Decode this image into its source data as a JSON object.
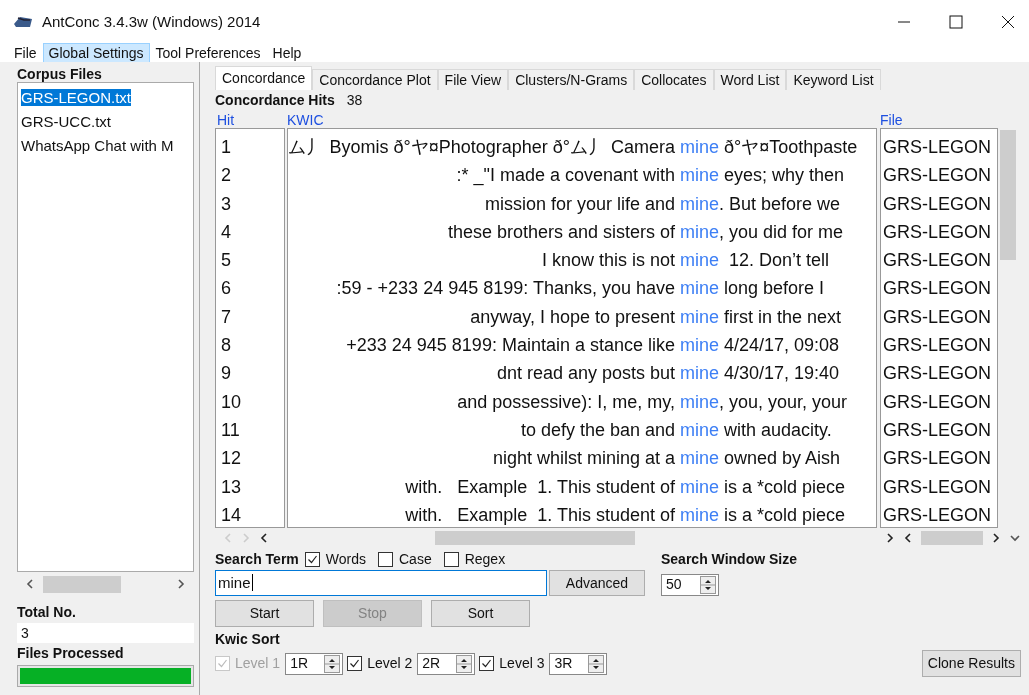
{
  "window": {
    "title": "AntConc 3.4.3w (Windows) 2014"
  },
  "menu": [
    {
      "label": "File",
      "selected": false
    },
    {
      "label": "Global Settings",
      "selected": true
    },
    {
      "label": "Tool Preferences",
      "selected": false
    },
    {
      "label": "Help",
      "selected": false
    }
  ],
  "corpus": {
    "heading": "Corpus Files",
    "files": [
      {
        "name": "GRS-LEGON.txt",
        "selected": true
      },
      {
        "name": "GRS-UCC.txt",
        "selected": false
      },
      {
        "name": "WhatsApp Chat with M",
        "selected": false
      }
    ],
    "total_label": "Total No.",
    "total": "3",
    "processed_label": "Files Processed",
    "progress": {
      "level": 1
    }
  },
  "tabs": [
    {
      "label": "Concordance",
      "selected": true
    },
    {
      "label": "Concordance Plot",
      "selected": false
    },
    {
      "label": "File View",
      "selected": false
    },
    {
      "label": "Clusters/N-Grams",
      "selected": false
    },
    {
      "label": "Collocates",
      "selected": false
    },
    {
      "label": "Word List",
      "selected": false
    },
    {
      "label": "Keyword List",
      "selected": false
    }
  ],
  "hits_label": "Concordance Hits",
  "hits": "38",
  "table": {
    "columns": [
      "Hit",
      "KWIC",
      "File"
    ],
    "rows": [
      {
        "hit": "1",
        "left": "ム丿 Byomis ð°ヤ¤Photographer ð°ム丿 Camera",
        "key": "mine",
        "right": " ð°ヤ¤Toothpaste",
        "file": "GRS-LEGON"
      },
      {
        "hit": "2",
        "left": ":* _\"I made a covenant with",
        "key": "mine",
        "right": " eyes; why then",
        "file": "GRS-LEGON"
      },
      {
        "hit": "3",
        "left": "mission for your life and",
        "key": "mine",
        "right": ". But before we",
        "file": "GRS-LEGON"
      },
      {
        "hit": "4",
        "left": "these brothers and sisters of",
        "key": "mine",
        "right": ", you did for me",
        "file": "GRS-LEGON"
      },
      {
        "hit": "5",
        "left": "I know this is not",
        "key": "mine",
        "right": "  12. Don’t tell",
        "file": "GRS-LEGON"
      },
      {
        "hit": "6",
        "left": ":59 - +233 24 945 8199: Thanks, you have",
        "key": "mine",
        "right": " long before I",
        "file": "GRS-LEGON"
      },
      {
        "hit": "7",
        "left": "anyway, I hope to present",
        "key": "mine",
        "right": " first in the next",
        "file": "GRS-LEGON"
      },
      {
        "hit": "8",
        "left": "+233 24 945 8199: Maintain a stance like",
        "key": "mine",
        "right": " 4/24/17, 09:08",
        "file": "GRS-LEGON"
      },
      {
        "hit": "9",
        "left": "dnt read any posts but",
        "key": "mine",
        "right": " 4/30/17, 19:40",
        "file": "GRS-LEGON"
      },
      {
        "hit": "10",
        "left": "and possessive): I, me, my,",
        "key": "mine",
        "right": ", you, your, your",
        "file": "GRS-LEGON"
      },
      {
        "hit": "11",
        "left": "to defy the ban and",
        "key": "mine",
        "right": " with audacity.",
        "file": "GRS-LEGON"
      },
      {
        "hit": "12",
        "left": "night whilst mining at a",
        "key": "mine",
        "right": " owned by Aish",
        "file": "GRS-LEGON"
      },
      {
        "hit": "13",
        "left": "with.   Example  1. This student of",
        "key": "mine",
        "right": " is a *cold piece",
        "file": "GRS-LEGON"
      },
      {
        "hit": "14",
        "left": "with.   Example  1. This student of",
        "key": "mine",
        "right": " is a *cold piece",
        "file": "GRS-LEGON"
      }
    ]
  },
  "search": {
    "label": "Search Term",
    "options": [
      {
        "label": "Words",
        "checked": true
      },
      {
        "label": "Case",
        "checked": false
      },
      {
        "label": "Regex",
        "checked": false
      }
    ],
    "value": "mine",
    "advanced": "Advanced",
    "window_label": "Search Window Size",
    "window_size": "50"
  },
  "actions": [
    {
      "label": "Start",
      "disabled": false
    },
    {
      "label": "Stop",
      "disabled": true
    },
    {
      "label": "Sort",
      "disabled": false
    }
  ],
  "kwic_sort": {
    "label": "Kwic Sort",
    "levels": [
      {
        "label": "Level 1",
        "value": "1R",
        "checked": true,
        "disabled": true
      },
      {
        "label": "Level 2",
        "value": "2R",
        "checked": true,
        "disabled": false
      },
      {
        "label": "Level 3",
        "value": "3R",
        "checked": true,
        "disabled": false
      }
    ]
  },
  "clone": "Clone Results"
}
